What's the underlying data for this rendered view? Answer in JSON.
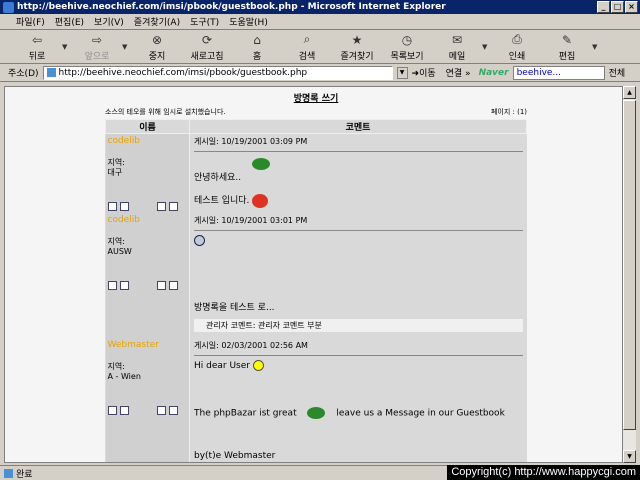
{
  "window": {
    "title": "http://beehive.neochief.com/imsi/pbook/guestbook.php - Microsoft Internet Explorer",
    "controls": [
      "_",
      "□",
      "×"
    ]
  },
  "menu": [
    "파일(F)",
    "편집(E)",
    "보기(V)",
    "즐겨찾기(A)",
    "도구(T)",
    "도움말(H)"
  ],
  "toolbar": [
    {
      "label": "뒤로",
      "icon": "back-arrow-icon",
      "glyph": "⇦",
      "disabled": false,
      "dropdown": true
    },
    {
      "label": "앞으로",
      "icon": "forward-arrow-icon",
      "glyph": "⇨",
      "disabled": true,
      "dropdown": true
    },
    {
      "label": "중지",
      "icon": "stop-icon",
      "glyph": "⊗",
      "disabled": false,
      "dropdown": false
    },
    {
      "label": "새로고침",
      "icon": "refresh-icon",
      "glyph": "⟳",
      "disabled": false,
      "dropdown": false
    },
    {
      "label": "홈",
      "icon": "home-icon",
      "glyph": "⌂",
      "disabled": false,
      "dropdown": false
    },
    {
      "label": "검색",
      "icon": "search-icon",
      "glyph": "⌕",
      "disabled": false,
      "dropdown": false
    },
    {
      "label": "즐겨찾기",
      "icon": "favorites-icon",
      "glyph": "★",
      "disabled": false,
      "dropdown": false
    },
    {
      "label": "목록보기",
      "icon": "history-icon",
      "glyph": "◷",
      "disabled": false,
      "dropdown": false
    },
    {
      "label": "메일",
      "icon": "mail-icon",
      "glyph": "✉",
      "disabled": false,
      "dropdown": true
    },
    {
      "label": "인쇄",
      "icon": "print-icon",
      "glyph": "⎙",
      "disabled": false,
      "dropdown": false
    },
    {
      "label": "편집",
      "icon": "edit-icon",
      "glyph": "✎",
      "disabled": false,
      "dropdown": true
    }
  ],
  "address": {
    "label": "주소(D)",
    "url": "http://beehive.neochief.com/imsi/pbook/guestbook.php",
    "go_label": "이동",
    "links_label": "연결 »",
    "naver_logo": "Naver",
    "search_value": "beehive...",
    "search_scope": "전체"
  },
  "status": {
    "text": "완료"
  },
  "copyright": "Copyright(c) http://www.happycgi.com",
  "guestbook": {
    "title": "방명록 쓰기",
    "notice": "소스의 테오를 위해 임시로 설치했습니다.",
    "page_info": "페이지 : (1)",
    "col_author": "이름",
    "col_comment": "코멘트",
    "entries": [
      {
        "name": "codelib",
        "region_label": "지역:",
        "region": "대구",
        "date": "게시일: 10/19/2001 03:09 PM",
        "line1": "안녕하세요..",
        "line2": "테스트 입니다.",
        "admin": ""
      },
      {
        "name": "codelib",
        "region_label": "지역:",
        "region": "AUSW",
        "date": "게시일: 10/19/2001 03:01 PM",
        "line1": "",
        "line2": "방명록을 테스트 로...",
        "admin": "관리자 코멘트: 관리자 코멘트 부분"
      },
      {
        "name": "Webmaster",
        "region_label": "지역:",
        "region": "A - Wien",
        "date": "게시일: 02/03/2001 02:56 AM",
        "line1": "Hi dear User",
        "line2a": "The phpBazar ist great",
        "line2b": "leave us a Message in our Guestbook",
        "line3": "by(t)e Webmaster",
        "admin": ""
      }
    ]
  }
}
